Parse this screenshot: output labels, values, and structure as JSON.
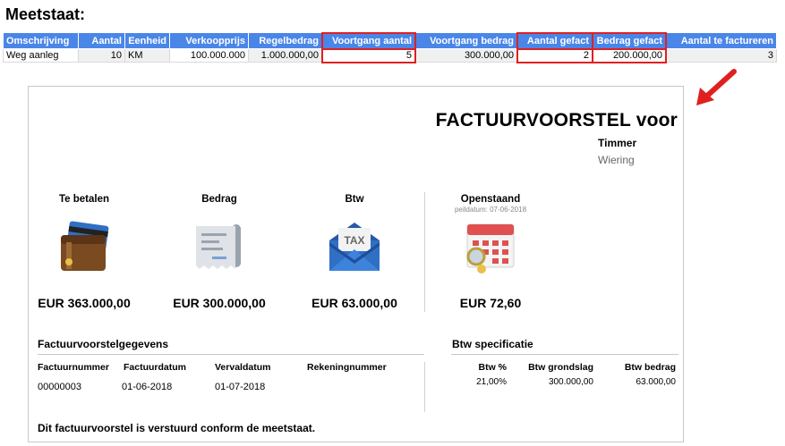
{
  "heading": "Meetstaat:",
  "table": {
    "columns": [
      "Omschrijving",
      "Aantal",
      "Eenheid",
      "Verkoopprijs",
      "Regelbedrag",
      "Voortgang aantal",
      "Voortgang bedrag",
      "Aantal gefact",
      "Bedrag gefact",
      "Aantal te factureren"
    ],
    "row": [
      "Weg aanleg",
      "10",
      "KM",
      "100.000.000",
      "1.000.000,00",
      "5",
      "300.000,00",
      "2",
      "200.000,00",
      "3"
    ]
  },
  "invoice": {
    "title": "FACTUURVOORSTEL voor",
    "company": "Timmer",
    "city": "Wiering",
    "summary": [
      {
        "label": "Te betalen",
        "icon": "wallet-icon",
        "amount": "EUR 363.000,00"
      },
      {
        "label": "Bedrag",
        "icon": "receipt-icon",
        "amount": "EUR 300.000,00"
      },
      {
        "label": "Btw",
        "icon": "tax-envelope-icon",
        "amount": "EUR 63.000,00"
      },
      {
        "label": "Openstaand",
        "sub": "peildatum: 07-06-2018",
        "icon": "calendar-icon",
        "amount": "EUR 72,60"
      }
    ],
    "details": {
      "heading": "Factuurvoorstelgegevens",
      "labels": [
        "Factuurnummer",
        "Factuurdatum",
        "Vervaldatum",
        "Rekeningnummer"
      ],
      "values": [
        "00000003",
        "01-06-2018",
        "01-07-2018",
        ""
      ]
    },
    "vat": {
      "heading": "Btw specificatie",
      "labels": [
        "Btw %",
        "Btw grondslag",
        "Btw bedrag"
      ],
      "values": [
        "21,00%",
        "300.000,00",
        "63.000,00"
      ]
    },
    "footer": "Dit factuurvoorstel is verstuurd conform de meetstaat."
  },
  "colors": {
    "header_blue": "#4a86e8",
    "highlight_red": "#e02020",
    "wallet_brown": "#8b5a2b",
    "envelope_blue": "#2f6fc4",
    "calendar_red": "#e05050"
  }
}
